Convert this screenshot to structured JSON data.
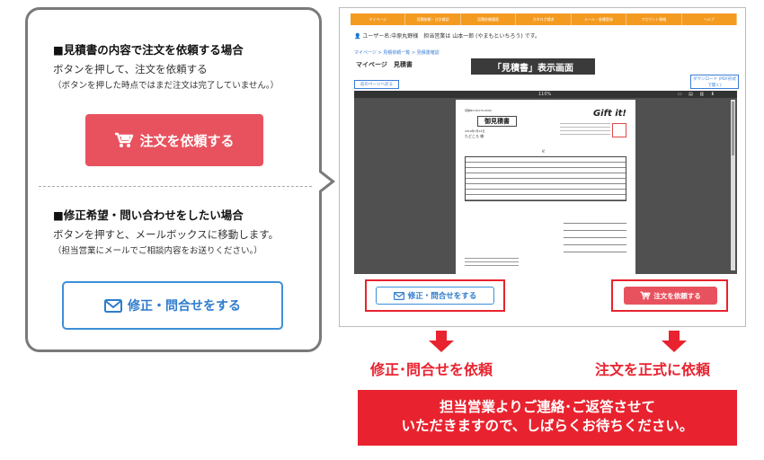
{
  "left_card": {
    "order_section": {
      "title": "■見積書の内容で注文を依頼する場合",
      "desc": "ボタンを押して、注文を依頼する",
      "note": "（ボタンを押した時点ではまだ注文は完了していません。）",
      "button_label": "注文を依頼する",
      "button_icon": "cart-icon"
    },
    "inquiry_section": {
      "title": "■修正希望・問い合わせをしたい場合",
      "desc": "ボタンを押すと、メールボックスに移動します。",
      "note": "（担当営業にメールでご相談内容をお送りください。）",
      "button_label": "修正・問合せをする",
      "button_icon": "mail-icon"
    }
  },
  "screenshot": {
    "nav_items": [
      "マイページ",
      "見積依頼・注文確認",
      "見積依頼履歴",
      "カタログ請求",
      "メール・各種登録",
      "アカウント情報",
      "ヘルプ"
    ],
    "user_line": "ユーザー名:中原丸野様　担当営業は 山本一郎 (やまもといちろう) です。",
    "breadcrumb": "マイページ  >  見積依頼一覧  >  見積書確認",
    "page_heading": "マイページ　見積書",
    "caption": "「見積書」表示画面",
    "back_button": "前のページへ戻る",
    "pdf_button": "ダウンロード (PDF形式で開く)",
    "viewer_zoom": "110%",
    "viewer_tools": "▭ ▤ ▥ ⬇",
    "doc": {
      "number": "見積NO.00170-0000",
      "title": "御見積書",
      "date": "2019年7月15日",
      "recipient": "たどころ 様",
      "logo": "Gift it!",
      "center_mark": "記"
    },
    "inquiry_button": "修正・問合せをする",
    "order_button": "注文を依頼する"
  },
  "results": {
    "inquiry": "修正･問合せを依頼",
    "order": "注文を正式に依頼"
  },
  "banner": {
    "line1": "担当営業よりご連絡･ご返答させて",
    "line2": "いただきますので、しばらくお待ちください。"
  },
  "colors": {
    "accent_red": "#e8232f",
    "button_red": "#e8525e",
    "link_blue": "#2f7ccc",
    "nav_orange": "#f39b21",
    "card_border": "#7a7a7a"
  }
}
